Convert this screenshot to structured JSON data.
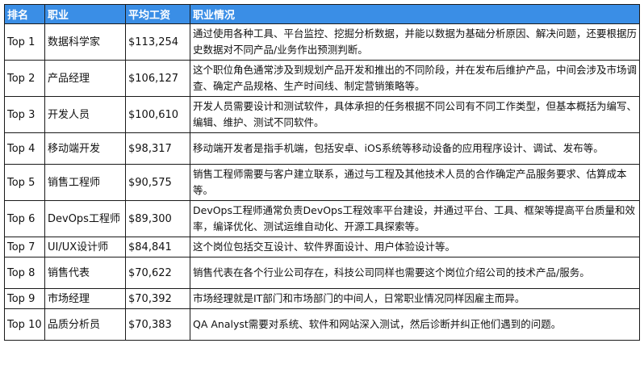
{
  "table": {
    "headers": [
      "排名",
      "职业",
      "平均工资",
      "职业情况"
    ],
    "rows": [
      {
        "rank": "Top 1",
        "job": "数据科学家",
        "salary": "$113,254",
        "desc": "通过使用各种工具、平台监控、挖掘分析数据，并能以数据为基础分析原因、解决问题，还要根据历史数据对不同产品/业务作出预测判断。"
      },
      {
        "rank": "Top 2",
        "job": "产品经理",
        "salary": "$106,127",
        "desc": "这个职位角色通常涉及到规划产品开发和推出的不同阶段，并在发布后维护产品，中间会涉及市场调查、确定产品规格、生产时间线、制定营销策略等。"
      },
      {
        "rank": "Top 3",
        "job": "开发人员",
        "salary": "$100,610",
        "desc": "开发人员需要设计和测试软件，具体承担的任务根据不同公司有不同工作类型，但基本概括为编写、编辑、维护、测试不同软件。"
      },
      {
        "rank": "Top 4",
        "job": "移动端开发",
        "salary": "$98,317",
        "desc": "移动端开发者是指手机端，包括安卓、iOS系统等移动设备的应用程序设计、调试、发布等。"
      },
      {
        "rank": "Top 5",
        "job": "销售工程师",
        "salary": "$90,575",
        "desc": "销售工程师需要与客户建立联系，通过与工程及其他技术人员的合作确定产品服务要求、估算成本等。"
      },
      {
        "rank": "Top 6",
        "job": "DevOps工程师",
        "salary": "$89,300",
        "desc": "DevOps工程师通常负责DevOps工程效率平台建设，并通过平台、工具、框架等提高平台质量和效率，编译优化、测试运维自动化、开源工具探索等。"
      },
      {
        "rank": "Top 7",
        "job": "UI/UX设计师",
        "salary": "$84,841",
        "desc": "这个岗位包括交互设计、软件界面设计、用户体验设计等。"
      },
      {
        "rank": "Top 8",
        "job": "销售代表",
        "salary": "$70,622",
        "desc": "销售代表在各个行业公司存在，科技公司同样也需要这个岗位介绍公司的技术产品/服务。"
      },
      {
        "rank": "Top 9",
        "job": "市场经理",
        "salary": "$70,392",
        "desc": "市场经理就是IT部门和市场部门的中间人，日常职业情况同样因雇主而异。"
      },
      {
        "rank": "Top 10",
        "job": "品质分析员",
        "salary": "$70,383",
        "desc": "QA Analyst需要对系统、软件和网站深入测试，然后诊断并纠正他们遇到的问题。"
      }
    ]
  },
  "colors": {
    "header_bg": "#3a8ee6",
    "header_text": "#ffffff",
    "border": "#1a1a1a"
  }
}
